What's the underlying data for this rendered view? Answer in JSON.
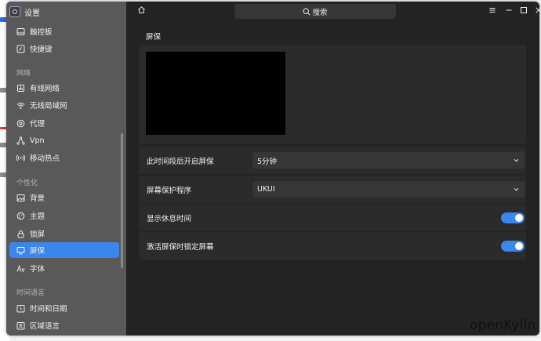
{
  "app": {
    "title": "设置"
  },
  "sidebar": {
    "items": [
      {
        "label": "触控板",
        "icon": "touchpad-icon"
      },
      {
        "label": "快捷键",
        "icon": "keyboard-shortcut-icon"
      },
      {
        "label": "有线网络",
        "icon": "wired-network-icon"
      },
      {
        "label": "无线局域网",
        "icon": "wifi-icon"
      },
      {
        "label": "代理",
        "icon": "proxy-icon"
      },
      {
        "label": "Vpn",
        "icon": "vpn-icon"
      },
      {
        "label": "移动热点",
        "icon": "hotspot-icon"
      },
      {
        "label": "背景",
        "icon": "background-icon"
      },
      {
        "label": "主题",
        "icon": "theme-icon"
      },
      {
        "label": "锁屏",
        "icon": "lock-screen-icon"
      },
      {
        "label": "屏保",
        "icon": "screensaver-icon",
        "active": true
      },
      {
        "label": "字体",
        "icon": "font-icon"
      },
      {
        "label": "时间和日期",
        "icon": "clock-icon"
      },
      {
        "label": "区域语言",
        "icon": "region-language-icon"
      }
    ],
    "groups": [
      "网络",
      "个性化",
      "时间语言"
    ]
  },
  "titlebar": {
    "search_label": "搜索"
  },
  "main": {
    "title": "屏保",
    "settings": [
      {
        "label": "此时间段后开启屏保",
        "type": "dropdown",
        "value": "5分钟"
      },
      {
        "label": "屏幕保护程序",
        "type": "dropdown",
        "value": "UKUI"
      },
      {
        "label": "显示休息时间",
        "type": "toggle",
        "on": true
      },
      {
        "label": "激活屏保时锁定屏幕",
        "type": "toggle",
        "on": true
      }
    ]
  },
  "watermark": "openKylin",
  "colors": {
    "accent": "#3a86ec",
    "sidebar_bg": "#595959",
    "window_bg": "#232323",
    "panel_bg": "#2b2b2b"
  }
}
